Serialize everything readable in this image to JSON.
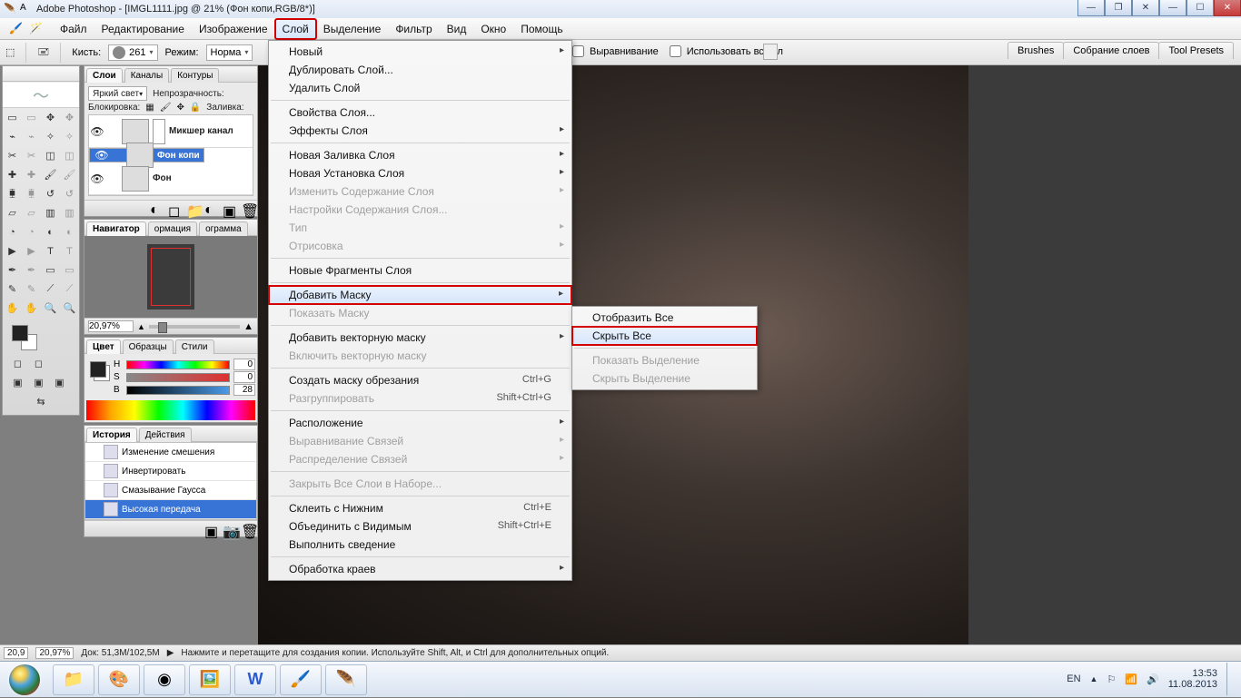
{
  "window": {
    "title": "Adobe Photoshop - [IMGL1111.jpg @ 21% (Фон копи,RGB/8*)]"
  },
  "menubar": {
    "items": [
      "Файл",
      "Редактирование",
      "Изображение",
      "Слой",
      "Выделение",
      "Фильтр",
      "Вид",
      "Окно",
      "Помощь"
    ],
    "open_index": 3
  },
  "optionsbar": {
    "brush_label": "Кисть:",
    "brush_size": "261",
    "mode_label": "Режим:",
    "mode_value": "Норма",
    "align_label": "Выравнивание",
    "useall_label": "Использовать все сл"
  },
  "right_tabs": [
    "Brushes",
    "Собрание слоев",
    "Tool Presets"
  ],
  "layers_panel": {
    "tabs": [
      "Слои",
      "Каналы",
      "Контуры"
    ],
    "blend_value": "Яркий свет",
    "opacity_label": "Непрозрачность:",
    "lock_label": "Блокировка:",
    "fill_label": "Заливка:",
    "rows": [
      {
        "name": "Микшер канал",
        "selected": false,
        "mask": true
      },
      {
        "name": "Фон копи",
        "selected": true,
        "mask": false
      },
      {
        "name": "Фон",
        "selected": false,
        "mask": false
      }
    ]
  },
  "navigator": {
    "tabs": [
      "Навигатор",
      "ормация",
      "ограмма"
    ],
    "zoom": "20,97%"
  },
  "color_panel": {
    "tabs": [
      "Цвет",
      "Образцы",
      "Стили"
    ],
    "h": "0",
    "s": "0",
    "b": "28"
  },
  "history_panel": {
    "tabs": [
      "История",
      "Действия"
    ],
    "items": [
      "Изменение смешения",
      "Инвертировать",
      "Смазывание Гаусса",
      "Высокая передача"
    ],
    "selected": 3
  },
  "dropdown": {
    "groups": [
      [
        {
          "t": "Новый",
          "sub": true
        },
        {
          "t": "Дублировать Слой..."
        },
        {
          "t": "Удалить Слой"
        }
      ],
      [
        {
          "t": "Свойства Слоя..."
        },
        {
          "t": "Эффекты Слоя",
          "sub": true
        }
      ],
      [
        {
          "t": "Новая Заливка Слоя",
          "sub": true
        },
        {
          "t": "Новая Установка Слоя",
          "sub": true
        },
        {
          "t": "Изменить Содержание Слоя",
          "dis": true,
          "sub": true
        },
        {
          "t": "Настройки Содержания Слоя...",
          "dis": true
        },
        {
          "t": "Тип",
          "dis": true,
          "sub": true
        },
        {
          "t": "Отрисовка",
          "dis": true,
          "sub": true
        }
      ],
      [
        {
          "t": "Новые Фрагменты Слоя"
        }
      ],
      [
        {
          "t": "Добавить Маску",
          "sub": true,
          "hover": true,
          "red": true
        },
        {
          "t": "Показать Маску",
          "dis": true
        }
      ],
      [
        {
          "t": "Добавить векторную маску",
          "sub": true
        },
        {
          "t": "Включить векторную маску",
          "dis": true
        }
      ],
      [
        {
          "t": "Создать маску обрезания",
          "s": "Ctrl+G"
        },
        {
          "t": "Разгруппировать",
          "dis": true,
          "s": "Shift+Ctrl+G"
        }
      ],
      [
        {
          "t": "Расположение",
          "sub": true
        },
        {
          "t": "Выравнивание Связей",
          "dis": true,
          "sub": true
        },
        {
          "t": "Распределение Связей",
          "dis": true,
          "sub": true
        }
      ],
      [
        {
          "t": "Закрыть Все Слои в Наборе...",
          "dis": true
        }
      ],
      [
        {
          "t": "Склеить с Нижним",
          "s": "Ctrl+E"
        },
        {
          "t": "Объединить с Видимым",
          "s": "Shift+Ctrl+E"
        },
        {
          "t": "Выполнить сведение"
        }
      ],
      [
        {
          "t": "Обработка краев",
          "sub": true
        }
      ]
    ]
  },
  "submenu": {
    "items": [
      {
        "t": "Отобразить Все"
      },
      {
        "t": "Скрыть Все",
        "hover": true,
        "red": true
      },
      {
        "t": "Показать Выделение",
        "dis": true
      },
      {
        "t": "Скрыть Выделение",
        "dis": true
      }
    ]
  },
  "statusbar": {
    "zoom1": "20,9",
    "zoom2": "20,97%",
    "doc": "Док: 51,3M/102,5M",
    "hint": "Нажмите и перетащите для создания копии.  Используйте Shift, Alt, и Ctrl для дополнительных опций."
  },
  "taskbar": {
    "lang": "EN",
    "time": "13:53",
    "date": "11.08.2013"
  }
}
